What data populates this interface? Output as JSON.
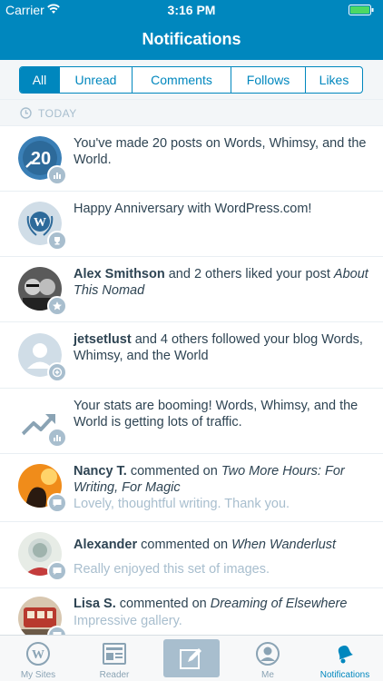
{
  "status_bar": {
    "carrier": "Carrier",
    "time": "3:16 PM"
  },
  "nav": {
    "title": "Notifications"
  },
  "filters": [
    {
      "label": "All",
      "active": true
    },
    {
      "label": "Unread",
      "active": false
    },
    {
      "label": "Comments",
      "active": false
    },
    {
      "label": "Follows",
      "active": false
    },
    {
      "label": "Likes",
      "active": false
    }
  ],
  "section": {
    "label": "TODAY"
  },
  "notifications": [
    {
      "badge_icon": "stats-icon",
      "text": "You've made 20 posts on Words, Whimsy, and the World.",
      "avatar_text": "20"
    },
    {
      "badge_icon": "trophy-icon",
      "text": "Happy Anniversary with WordPress.com!"
    },
    {
      "badge_icon": "star-icon",
      "actor": "Alex Smithson",
      "text": " and 2 others liked your post ",
      "target": "About This Nomad"
    },
    {
      "badge_icon": "follow-icon",
      "actor": "jetsetlust",
      "text": " and 4 others followed your blog Words, Whimsy, and the World"
    },
    {
      "badge_icon": "stats-icon",
      "text": "Your stats are booming! Words, Whimsy, and the World is getting lots of traffic."
    },
    {
      "badge_icon": "comment-icon",
      "actor": "Nancy T.",
      "text": " commented on ",
      "target": "Two More Hours: For Writing, For Magic",
      "snippet": "Lovely, thoughtful writing. Thank you."
    },
    {
      "badge_icon": "comment-icon",
      "actor": "Alexander",
      "text": " commented on ",
      "target": "When Wanderlust",
      "snippet": "Really enjoyed this set of images."
    },
    {
      "badge_icon": "comment-icon",
      "actor": "Lisa S.",
      "text": " commented on ",
      "target": "Dreaming of Elsewhere",
      "snippet": "Impressive gallery."
    }
  ],
  "tabbar": [
    {
      "label": "My Sites",
      "icon": "wordpress-icon",
      "active": false
    },
    {
      "label": "Reader",
      "icon": "reader-icon",
      "active": false
    },
    {
      "label": "",
      "icon": "write-icon",
      "active": false
    },
    {
      "label": "Me",
      "icon": "me-icon",
      "active": false
    },
    {
      "label": "Notifications",
      "icon": "bell-icon",
      "active": true
    }
  ],
  "colors": {
    "brand_blue": "#0087be",
    "text_dark": "#2e4453",
    "muted": "#a8bece"
  }
}
